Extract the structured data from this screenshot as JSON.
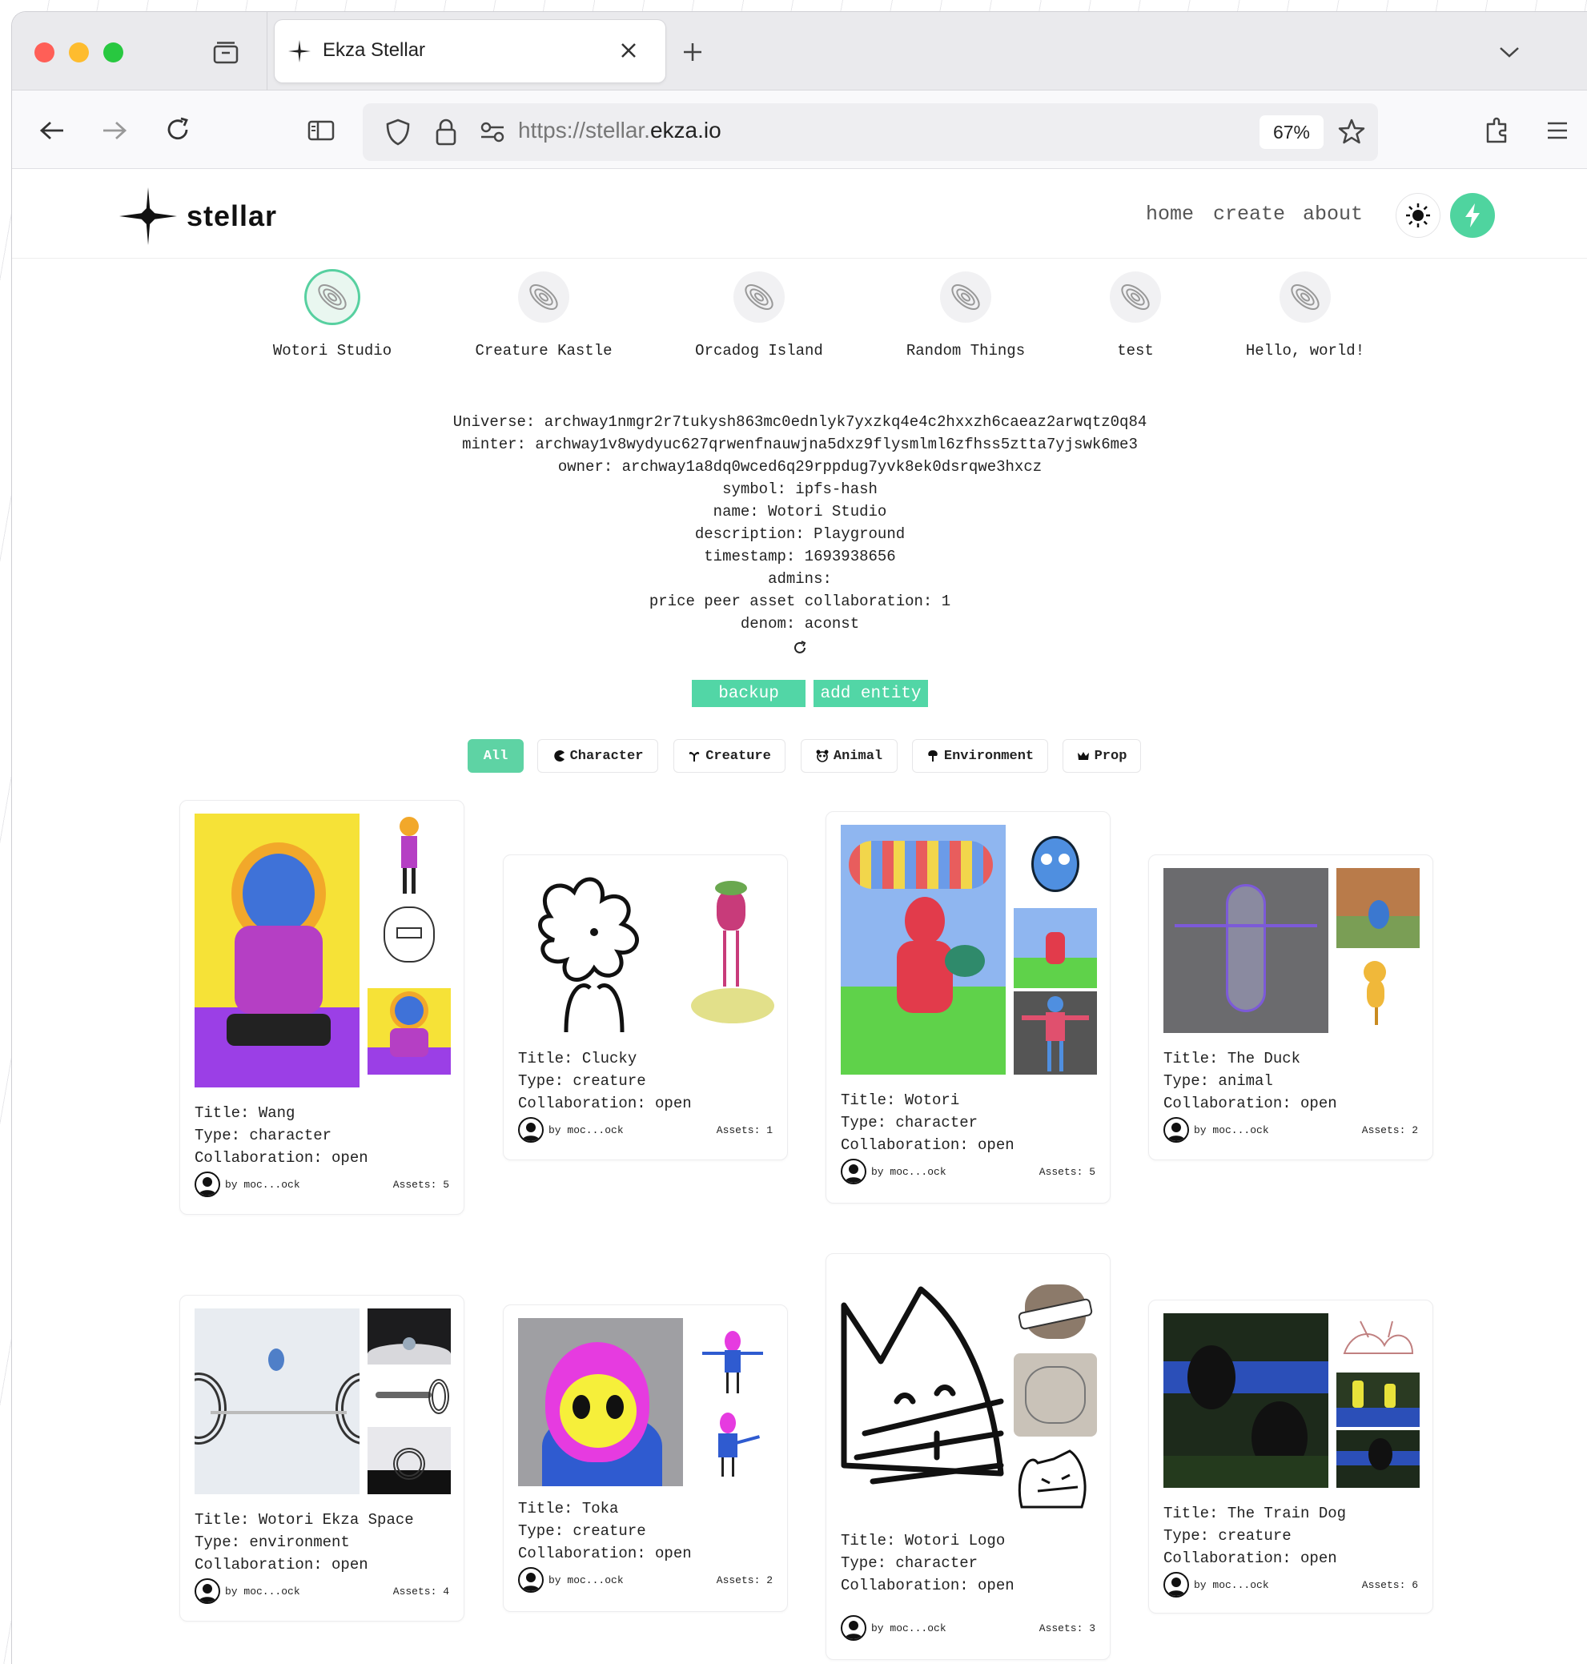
{
  "browser": {
    "tab_title": "Ekza Stellar",
    "url_prefix": "https://stellar.",
    "url_domain": "ekza.io",
    "zoom": "67%"
  },
  "site": {
    "logo_text": "stellar",
    "nav": [
      "home",
      "create",
      "about"
    ]
  },
  "universes": [
    {
      "label": "Wotori Studio",
      "selected": true
    },
    {
      "label": "Creature Kastle",
      "selected": false
    },
    {
      "label": "Orcadog Island",
      "selected": false
    },
    {
      "label": "Random Things",
      "selected": false
    },
    {
      "label": "test",
      "selected": false
    },
    {
      "label": "Hello, world!",
      "selected": false
    }
  ],
  "info": [
    "Universe: archway1nmgr2r7tukysh863mc0ednlyk7yxzkq4e4c2hxxzh6caeaz2arwqtz0q84",
    "minter: archway1v8wydyuc627qrwenfnauwjna5dxz9flysmlml6zfhss5ztta7yjswk6me3",
    "owner: archway1a8dq0wced6q29rppdug7yvk8ek0dsrqwe3hxcz",
    "symbol: ipfs-hash",
    "name: Wotori Studio",
    "description: Playground",
    "timestamp: 1693938656",
    "admins:",
    "price peer asset collaboration: 1",
    "denom: aconst"
  ],
  "actions": {
    "backup": "backup",
    "add_entity": "add entity"
  },
  "filters": [
    {
      "label": "All",
      "icon": "",
      "active": true
    },
    {
      "label": "Character",
      "icon": "pacman-icon",
      "active": false
    },
    {
      "label": "Creature",
      "icon": "creature-icon",
      "active": false
    },
    {
      "label": "Animal",
      "icon": "panda-icon",
      "active": false
    },
    {
      "label": "Environment",
      "icon": "tree-icon",
      "active": false
    },
    {
      "label": "Prop",
      "icon": "crown-icon",
      "active": false
    }
  ],
  "cards": [
    {
      "title": "Title: Wang",
      "type": "Type: character",
      "collab": "Collaboration: open",
      "author": "by moc...ock",
      "assets": "Assets: 5"
    },
    {
      "title": "Title: Clucky",
      "type": "Type: creature",
      "collab": "Collaboration: open",
      "author": "by moc...ock",
      "assets": "Assets: 1"
    },
    {
      "title": "Title: Wotori",
      "type": "Type: character",
      "collab": "Collaboration: open",
      "author": "by moc...ock",
      "assets": "Assets: 5"
    },
    {
      "title": "Title: The Duck",
      "type": "Type: animal",
      "collab": "Collaboration: open",
      "author": "by moc...ock",
      "assets": "Assets: 2"
    },
    {
      "title": "Title: Wotori Ekza Space",
      "type": "Type: environment",
      "collab": "Collaboration: open",
      "author": "by moc...ock",
      "assets": "Assets: 4"
    },
    {
      "title": "Title: Toka",
      "type": "Type: creature",
      "collab": "Collaboration: open",
      "author": "by moc...ock",
      "assets": "Assets: 2"
    },
    {
      "title": "Title: Wotori Logo",
      "type": "Type: character",
      "collab": "Collaboration: open",
      "author": "by moc...ock",
      "assets": "Assets: 3"
    },
    {
      "title": "Title: The Train Dog",
      "type": "Type: creature",
      "collab": "Collaboration: open",
      "author": "by moc...ock",
      "assets": "Assets: 6"
    }
  ]
}
